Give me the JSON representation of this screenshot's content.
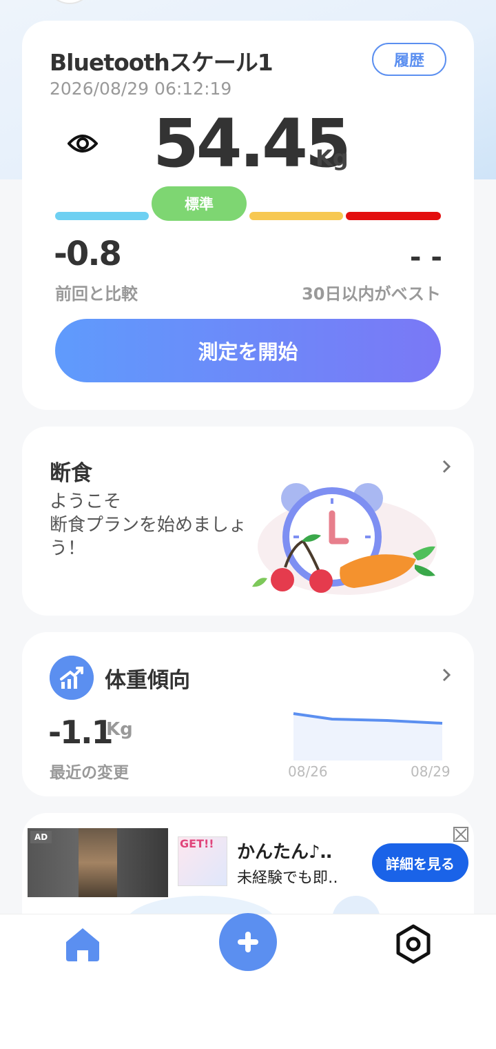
{
  "scale_card": {
    "device_name": "Bluetoothスケール1",
    "history_label": "履歴",
    "timestamp": "2026/08/29 06:12:19",
    "weight": "54.45",
    "unit": "Kg",
    "status": "標準",
    "diff_value": "-0.8",
    "diff_label": "前回と比較",
    "best_value": "- -",
    "best_label": "30日以内がベスト",
    "start_label": "測定を開始",
    "colors": {
      "underweight": "#6ed0f2",
      "normal": "#7ed672",
      "overweight": "#f7c852",
      "obese": "#e30f0f",
      "accent": "#5b8ff0"
    }
  },
  "fasting_card": {
    "title": "断食",
    "text": "ようこそ\n断食プランを始めましょう！"
  },
  "trend_card": {
    "title": "体重傾向",
    "value": "-1.1",
    "unit": "Kg",
    "label": "最近の変更",
    "x_start": "08/26",
    "x_end": "08/29"
  },
  "ad": {
    "badge": "AD",
    "thumb_text": "GET!!",
    "title": "かんたん♪‥",
    "description": "未経験でも即‥",
    "cta": "詳細を見る"
  },
  "nav": {
    "items": [
      "home-icon",
      "add-icon",
      "settings-icon"
    ]
  }
}
